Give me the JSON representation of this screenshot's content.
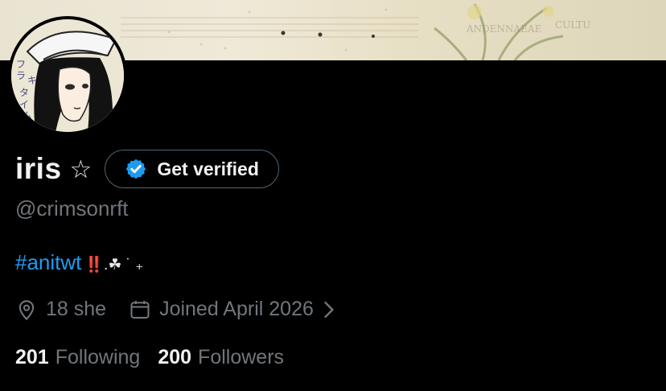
{
  "profile": {
    "display_name": "iris",
    "name_decoration": "☆",
    "handle": "@crimsonrft",
    "bio_hashtag": "#anitwt",
    "bio_decoration": "‼️.☘︎ ˙ ₊",
    "location": "18 she",
    "joined": "Joined April 2026",
    "following_count": "201",
    "following_label": "Following",
    "followers_count": "200",
    "followers_label": "Followers"
  },
  "verify": {
    "label": "Get verified"
  },
  "icons": {
    "verify": "verified-badge-icon",
    "location": "location-pin-icon",
    "calendar": "calendar-icon",
    "chevron": "chevron-right-icon"
  },
  "colors": {
    "background": "#000000",
    "link": "#1d9bf0",
    "muted": "#71767b",
    "verify_badge": "#1d9bf0",
    "button_border": "#536471"
  }
}
